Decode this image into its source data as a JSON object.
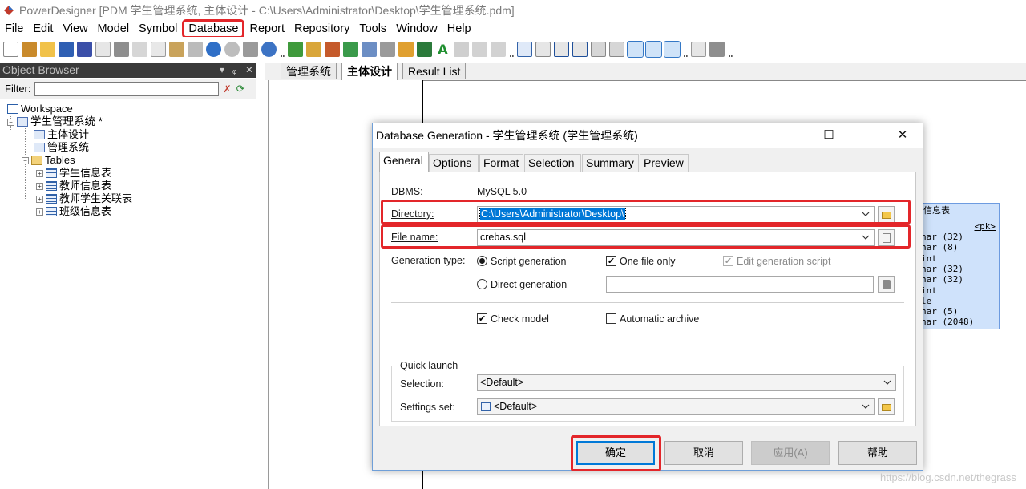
{
  "window": {
    "title": "PowerDesigner [PDM 学生管理系统, 主体设计 - C:\\Users\\Administrator\\Desktop\\学生管理系统.pdm]"
  },
  "menu": [
    "File",
    "Edit",
    "View",
    "Model",
    "Symbol",
    "Database",
    "Report",
    "Repository",
    "Tools",
    "Window",
    "Help"
  ],
  "object_browser": {
    "title": "Object Browser",
    "filter_label": "Filter:",
    "filter_value": "",
    "tree": {
      "workspace": "Workspace",
      "model": "学生管理系统 *",
      "diagrams": [
        "主体设计",
        "管理系统"
      ],
      "tables_folder": "Tables",
      "tables": [
        "学生信息表",
        "教师信息表",
        "教师学生关联表",
        "班级信息表"
      ]
    }
  },
  "tabs": [
    "管理系统",
    "主体设计",
    "Result List"
  ],
  "entity": {
    "title": "信息表",
    "pk": "<pk>",
    "rows": [
      "nar (32)",
      "nar (8)",
      "int",
      "nar (32)",
      "nar (32)",
      "int",
      "le",
      "nar (5)",
      "nar (2048)"
    ]
  },
  "dialog": {
    "title": "Database Generation - 学生管理系统 (学生管理系统)",
    "tabs": [
      "General",
      "Options",
      "Format",
      "Selection",
      "Summary",
      "Preview"
    ],
    "dbms_label": "DBMS:",
    "dbms_value": "MySQL 5.0",
    "directory_label": "Directory:",
    "directory_value": "C:\\Users\\Administrator\\Desktop\\",
    "filename_label": "File name:",
    "filename_value": "crebas.sql",
    "gentype_label": "Generation type:",
    "script_generation": "Script generation",
    "direct_generation": "Direct generation",
    "one_file_only": "One file only",
    "edit_generation_script": "Edit generation script",
    "check_model": "Check model",
    "automatic_archive": "Automatic archive",
    "quick_launch": "Quick launch",
    "selection_label": "Selection:",
    "selection_value": "<Default>",
    "settings_label": "Settings set:",
    "settings_value": "<Default>",
    "buttons": {
      "ok": "确定",
      "cancel": "取消",
      "apply": "应用(A)",
      "help": "帮助"
    }
  },
  "watermark": "https://blog.csdn.net/thegrass",
  "colors": {
    "highlight_red": "#e3262a",
    "selection_blue": "#0078d7",
    "entity_fill": "#cfe2fb"
  }
}
